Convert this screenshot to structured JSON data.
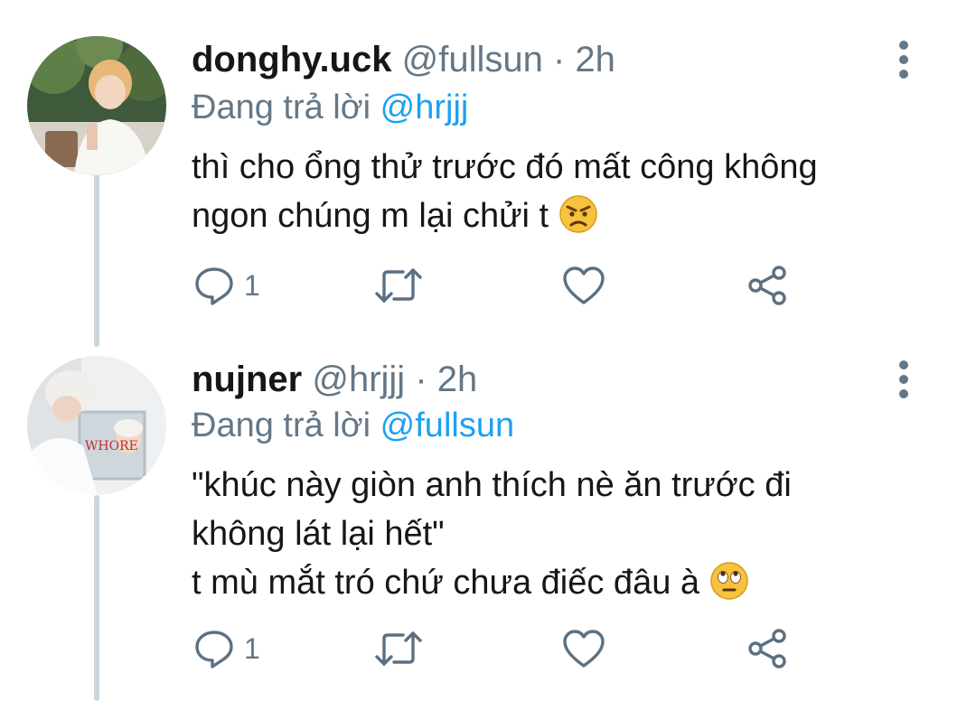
{
  "tweets": [
    {
      "name": "donghy.uck",
      "handle": "@fullsun",
      "separator": "·",
      "time": "2h",
      "reply_prefix": "Đang trả lời",
      "reply_mention": "@hrjjj",
      "text_lines": [
        "thì cho ổng thử trước đó mất công không",
        "ngon chúng m lại chửi t"
      ],
      "emoji": "angry-face",
      "reply_count": "1",
      "avatar_icon": "avatar-photo-blonde-person"
    },
    {
      "name": "nujner",
      "handle": "@hrjjj",
      "separator": "·",
      "time": "2h",
      "reply_prefix": "Đang trả lời",
      "reply_mention": "@fullsun",
      "text_lines": [
        "\"khúc này giòn anh thích nè ăn trước đi",
        "không lát lại hết\"",
        "t mù mắt tró chứ chưa điếc đâu à"
      ],
      "emoji": "face-with-rolling-eyes",
      "reply_count": "1",
      "avatar_icon": "avatar-photo-mirror-whore"
    }
  ],
  "colors": {
    "text": "#14171a",
    "secondary": "#657786",
    "link": "#1da1f2",
    "thread_line": "#ccd6dd",
    "icon": "#5b7083"
  },
  "icons": [
    "reply-icon",
    "retweet-icon",
    "like-icon",
    "share-icon",
    "more-options-icon"
  ]
}
